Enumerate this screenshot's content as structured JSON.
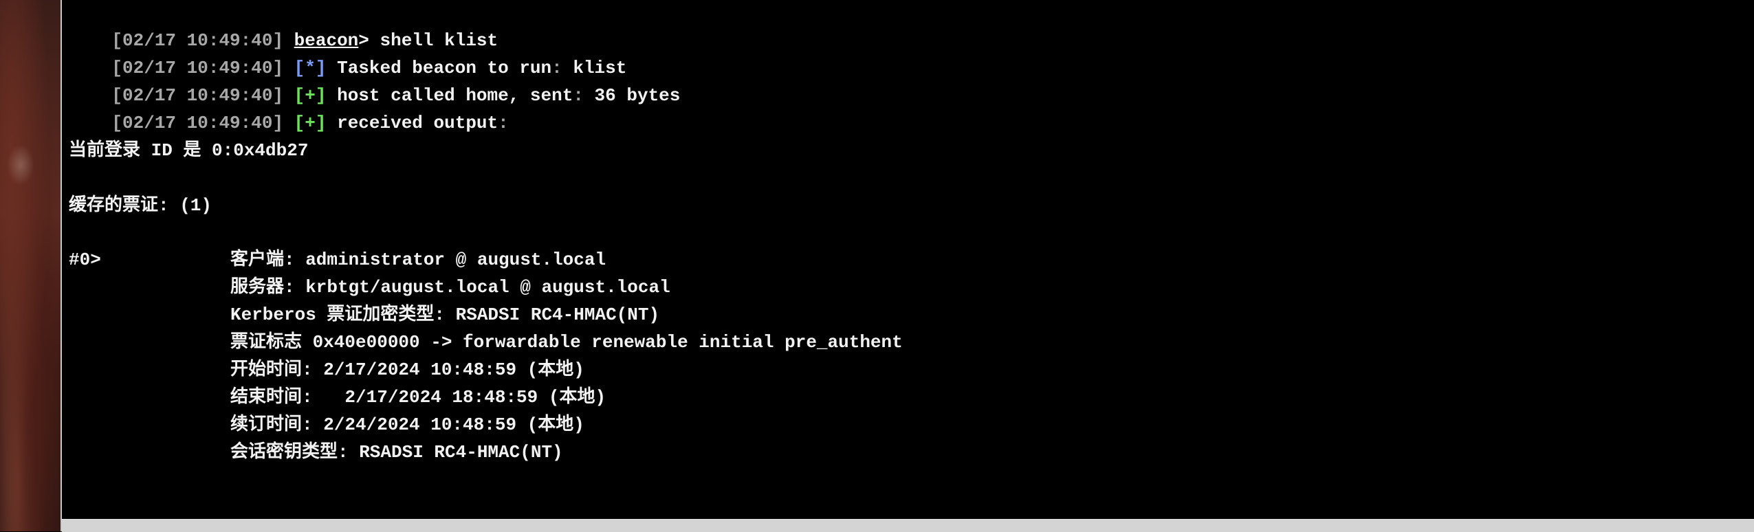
{
  "terminal": {
    "lines": [
      {
        "ts": "[02/17 10:49:40]",
        "prompt": "beacon",
        "cmd": "> shell klist"
      },
      {
        "ts": "[02/17 10:49:40]",
        "tag": "[*]",
        "text_a": " Tasked beacon to run",
        "sep": ":",
        "text_b": " klist"
      },
      {
        "ts": "[02/17 10:49:40]",
        "tag": "[+]",
        "text_a": " host called home, sent",
        "sep": ":",
        "text_b": " 36 bytes"
      },
      {
        "ts": "[02/17 10:49:40]",
        "tag": "[+]",
        "text_a": " received output",
        "sep": ":",
        "text_b": ""
      }
    ],
    "logon_id": "当前登录 ID 是 0:0x4db27",
    "cached_tickets": "缓存的票证: (1)",
    "ticket_index": "#0>",
    "ticket_fields": [
      "客户端: administrator @ august.local",
      "服务器: krbtgt/august.local @ august.local",
      "Kerberos 票证加密类型: RSADSI RC4-HMAC(NT)",
      "票证标志 0x40e00000 -> forwardable renewable initial pre_authent",
      "开始时间: 2/17/2024 10:48:59 (本地)",
      "结束时间:   2/17/2024 18:48:59 (本地)",
      "续订时间: 2/24/2024 10:48:59 (本地)",
      "会话密钥类型: RSADSI RC4-HMAC(NT)"
    ]
  },
  "colors": {
    "background": "#000000",
    "text": "#f2f2f2",
    "timestamp": "#a8a8a8",
    "info_tag": "#7a9cf7",
    "success_tag": "#6de35c"
  }
}
